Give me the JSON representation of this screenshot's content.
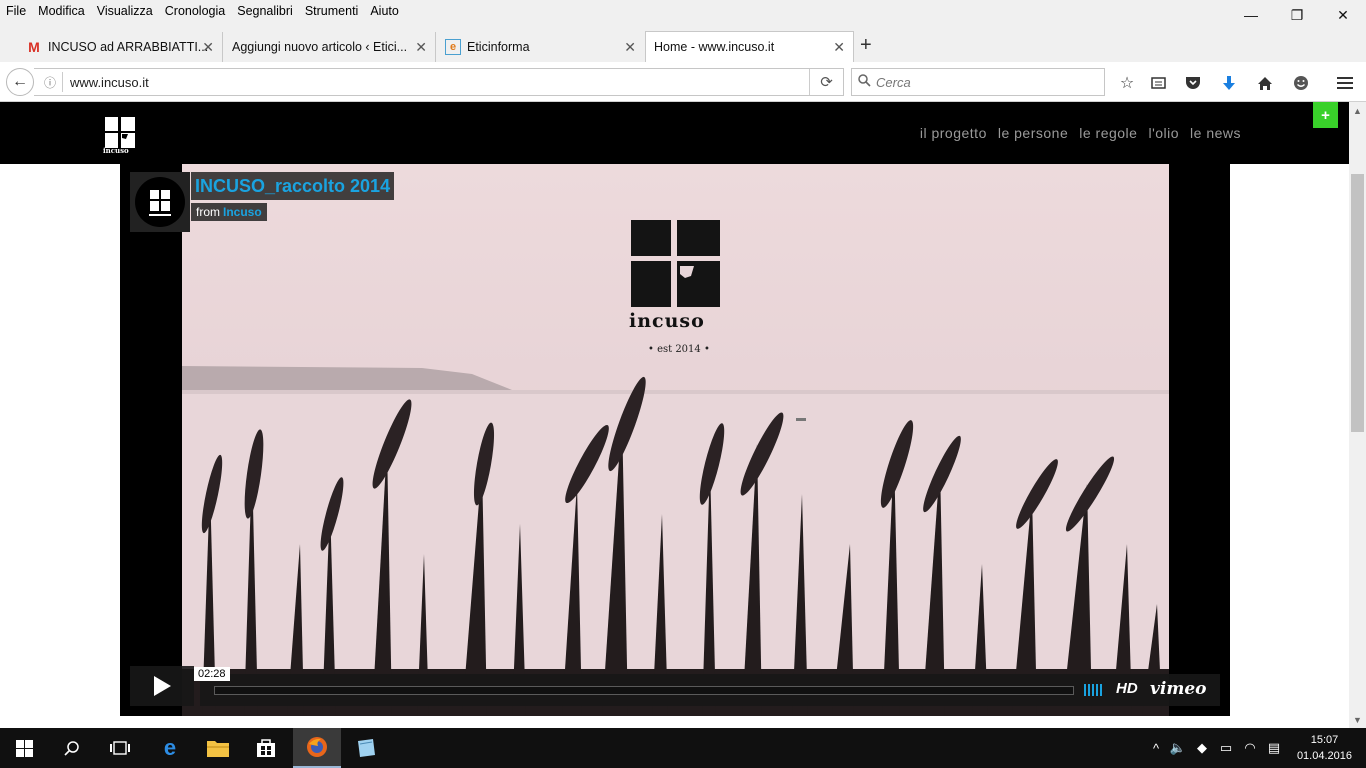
{
  "menu": [
    "File",
    "Modifica",
    "Visualizza",
    "Cronologia",
    "Segnalibri",
    "Strumenti",
    "Aiuto"
  ],
  "window_controls": {
    "minimize": "—",
    "restore": "❐",
    "close": "✕"
  },
  "tabs": [
    {
      "title": "INCUSO ad ARRABBIATTI...",
      "favicon": "gmail-icon"
    },
    {
      "title": "Aggiungi nuovo articolo ‹ Etici...",
      "favicon": "wordpress-icon"
    },
    {
      "title": "Eticinforma",
      "favicon": "eticinforma-icon"
    },
    {
      "title": "Home - www.incuso.it",
      "favicon": "none",
      "active": true
    }
  ],
  "urlbar": {
    "url": "www.incuso.it"
  },
  "searchbar": {
    "placeholder": "Cerca"
  },
  "site": {
    "nav": [
      "il progetto",
      "le persone",
      "le regole",
      "l'olio",
      "le news"
    ],
    "logo_text": "incuso"
  },
  "video": {
    "title": "INCUSO_raccolto 2014",
    "from_label": "from",
    "author": "Incuso",
    "logo_text": "incuso",
    "est_text": "• est 2014 •",
    "time": "02:28",
    "hd_label": "HD",
    "brand": "vimeo"
  },
  "taskbar": {
    "time": "15:07",
    "date": "01.04.2016"
  },
  "colors": {
    "accent": "#1aa3e0",
    "video_bg": "#e9d6d8",
    "header_bg": "#000000",
    "green_button": "#39d12a"
  }
}
